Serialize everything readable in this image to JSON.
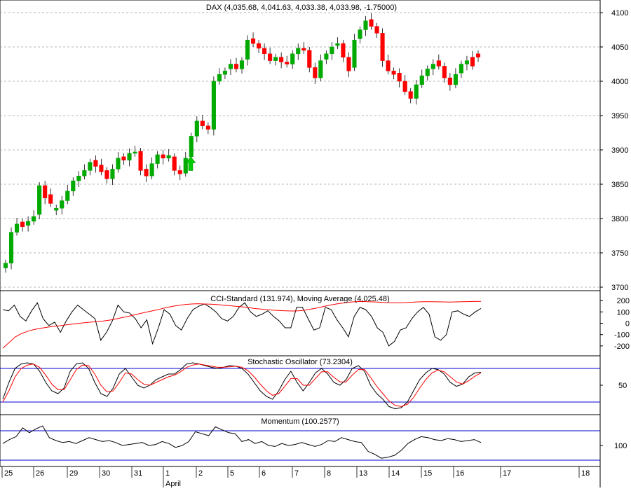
{
  "chart_data": [
    {
      "panel": "price",
      "type": "candlestick",
      "title": "DAX (4,035.68, 4,041.63, 4,033.38, 4,033.98, -1.75000)",
      "ylim": [
        3700,
        4100
      ],
      "yticks": [
        3700,
        3750,
        3800,
        3850,
        3900,
        3950,
        4000,
        4050,
        4100
      ],
      "grid": true,
      "up_color": "#00aa00",
      "down_color": "#ff0000",
      "signal_arrow": {
        "label": "buy-arrow",
        "color": "#00cc00",
        "at_day": "2",
        "value": 3878
      },
      "closes": [
        3735,
        3780,
        3792,
        3788,
        3796,
        3803,
        3848,
        3830,
        3822,
        3815,
        3826,
        3840,
        3855,
        3862,
        3870,
        3882,
        3876,
        3868,
        3858,
        3872,
        3888,
        3885,
        3895,
        3897,
        3870,
        3862,
        3880,
        3893,
        3888,
        3892,
        3870,
        3865,
        3888,
        3920,
        3942,
        3935,
        3930,
        4000,
        4010,
        4015,
        4025,
        4018,
        4030,
        4060,
        4055,
        4048,
        4040,
        4030,
        4035,
        4028,
        4025,
        4040,
        4048,
        4045,
        4020,
        4005,
        4030,
        4040,
        4050,
        4055,
        4035,
        4015,
        4060,
        4075,
        4088,
        4080,
        4070,
        4030,
        4015,
        4010,
        4000,
        3985,
        3975,
        3995,
        4008,
        4018,
        4025,
        4022,
        4005,
        3995,
        4010,
        4025,
        4030,
        4022,
        4035
      ],
      "opens": [
        3728,
        3735,
        3780,
        3795,
        3790,
        3796,
        3806,
        3848,
        3835,
        3812,
        3815,
        3826,
        3840,
        3855,
        3862,
        3870,
        3885,
        3878,
        3870,
        3858,
        3872,
        3890,
        3885,
        3895,
        3898,
        3872,
        3862,
        3880,
        3893,
        3888,
        3890,
        3870,
        3866,
        3890,
        3920,
        3942,
        3935,
        3930,
        4000,
        4010,
        4018,
        4025,
        4018,
        4032,
        4062,
        4055,
        4048,
        4040,
        4030,
        4035,
        4028,
        4025,
        4040,
        4048,
        4045,
        4020,
        4005,
        4032,
        4040,
        4052,
        4055,
        4035,
        4020,
        4062,
        4075,
        4090,
        4080,
        4070,
        4030,
        4015,
        4012,
        4000,
        3985,
        3975,
        3995,
        4008,
        4018,
        4030,
        4022,
        4005,
        3995,
        4012,
        4025,
        4035,
        4040
      ]
    },
    {
      "panel": "cci",
      "type": "line",
      "title": "CCI-Standard (131.974), Moving Average (4,025.48)",
      "ylim": [
        -250,
        250
      ],
      "yticks": [
        200,
        100,
        0,
        -100,
        -200
      ],
      "series": [
        {
          "name": "CCI-Standard",
          "color": "#000000",
          "values": [
            120,
            110,
            160,
            60,
            20,
            110,
            180,
            40,
            -20,
            10,
            -80,
            20,
            100,
            160,
            120,
            80,
            40,
            -150,
            -80,
            20,
            160,
            100,
            90,
            40,
            -40,
            30,
            -180,
            -40,
            120,
            80,
            -20,
            -60,
            40,
            120,
            150,
            170,
            140,
            100,
            40,
            20,
            60,
            140,
            180,
            100,
            60,
            80,
            110,
            60,
            20,
            -40,
            -40,
            140,
            140,
            40,
            -60,
            -40,
            140,
            120,
            30,
            -40,
            -120,
            60,
            140,
            120,
            60,
            -40,
            -80,
            -200,
            -160,
            -60,
            -40,
            40,
            100,
            140,
            80,
            -120,
            -150,
            -100,
            100,
            110,
            80,
            60,
            100,
            130
          ]
        },
        {
          "name": "Moving Average",
          "color": "#ff0000",
          "values": [
            -220,
            -170,
            -120,
            -90,
            -70,
            -55,
            -45,
            -35,
            -28,
            -22,
            -15,
            -8,
            -2,
            5,
            10,
            15,
            20,
            28,
            38,
            50,
            62,
            75,
            88,
            100,
            112,
            125,
            138,
            150,
            158,
            165,
            170,
            172,
            170,
            168,
            165,
            160,
            155,
            150,
            145,
            138,
            130,
            125,
            120,
            115,
            112,
            110,
            108,
            110,
            115,
            125,
            135,
            148,
            160,
            170,
            178,
            185,
            190,
            192,
            190,
            188,
            185,
            182,
            180,
            180,
            182,
            185,
            188,
            190,
            190,
            189,
            188,
            187,
            188,
            190,
            191,
            192,
            193
          ]
        }
      ]
    },
    {
      "panel": "stochastic",
      "type": "line",
      "title": "Stochastic Oscillator (73.2304)",
      "ylim": [
        0,
        100
      ],
      "yticks": [
        50
      ],
      "reference_lines": [
        80,
        20
      ],
      "series": [
        {
          "name": "%K",
          "color": "#000000",
          "values": [
            25,
            55,
            80,
            88,
            90,
            88,
            75,
            55,
            40,
            35,
            45,
            75,
            88,
            90,
            80,
            55,
            35,
            30,
            45,
            70,
            80,
            65,
            50,
            45,
            50,
            60,
            65,
            70,
            70,
            78,
            88,
            90,
            88,
            85,
            82,
            80,
            82,
            85,
            84,
            80,
            70,
            55,
            40,
            30,
            25,
            40,
            60,
            75,
            55,
            40,
            55,
            72,
            80,
            70,
            55,
            50,
            60,
            80,
            85,
            75,
            50,
            35,
            25,
            12,
            8,
            10,
            20,
            40,
            60,
            72,
            80,
            78,
            70,
            55,
            48,
            52,
            65,
            72,
            73
          ]
        },
        {
          "name": "%D",
          "color": "#ff0000",
          "values": [
            20,
            40,
            65,
            80,
            86,
            88,
            82,
            68,
            52,
            42,
            42,
            60,
            78,
            86,
            85,
            70,
            50,
            38,
            40,
            55,
            72,
            70,
            60,
            52,
            50,
            55,
            60,
            65,
            68,
            74,
            82,
            86,
            88,
            86,
            84,
            82,
            82,
            83,
            84,
            82,
            76,
            65,
            52,
            40,
            32,
            35,
            48,
            62,
            62,
            50,
            50,
            62,
            74,
            74,
            64,
            56,
            56,
            68,
            78,
            78,
            64,
            48,
            35,
            22,
            14,
            12,
            16,
            28,
            45,
            60,
            72,
            77,
            74,
            65,
            56,
            52,
            58,
            66,
            72
          ]
        }
      ]
    },
    {
      "panel": "momentum",
      "type": "line",
      "title": "Momentum (100.2577)",
      "ylim": [
        98,
        103
      ],
      "yticks": [
        100
      ],
      "reference_lines": [
        101.5,
        98.5
      ],
      "series": [
        {
          "name": "Momentum",
          "color": "#000000",
          "values": [
            100.2,
            100.6,
            100.9,
            101.8,
            101.3,
            101.7,
            102.0,
            100.8,
            100.5,
            100.3,
            100.4,
            100.2,
            100.5,
            100.8,
            100.6,
            100.4,
            100.5,
            100.3,
            100.0,
            100.1,
            100.2,
            100.3,
            100.0,
            100.1,
            100.4,
            100.2,
            99.8,
            100.0,
            100.4,
            101.4,
            101.2,
            101.0,
            101.9,
            101.6,
            101.3,
            101.2,
            100.4,
            100.6,
            100.2,
            100.4,
            100.0,
            99.9,
            100.2,
            100.0,
            100.1,
            100.3,
            100.1,
            99.9,
            100.1,
            100.5,
            100.4,
            100.8,
            100.6,
            100.4,
            100.3,
            99.4,
            99.1,
            98.7,
            98.8,
            99.0,
            99.5,
            100.2,
            100.6,
            100.9,
            100.8,
            100.6,
            100.5,
            100.7,
            100.6,
            100.4,
            100.5,
            100.6,
            100.3
          ]
        }
      ]
    },
    {
      "panel": "x_axis",
      "type": "axis",
      "categories": [
        "25",
        "26",
        "29",
        "30",
        "31",
        "1",
        "2",
        "5",
        "6",
        "7",
        "8",
        "13",
        "14",
        "15",
        "16",
        "17",
        "18"
      ],
      "month_label": "April"
    }
  ]
}
